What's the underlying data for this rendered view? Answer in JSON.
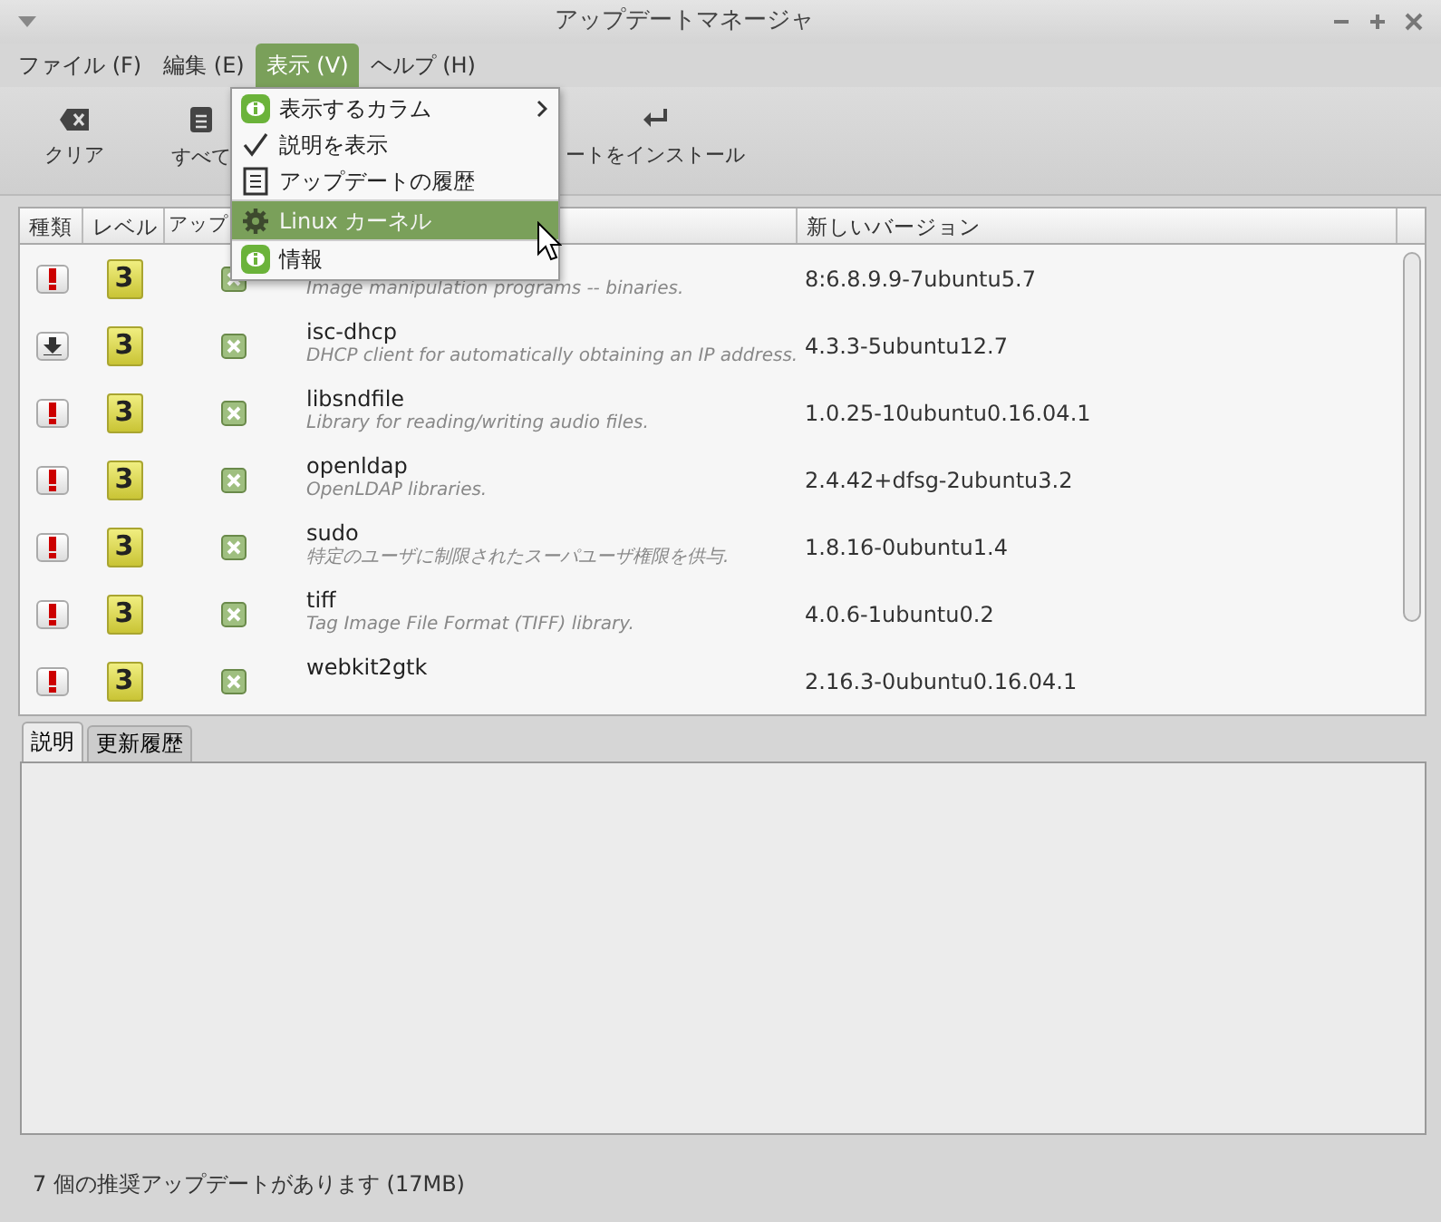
{
  "window": {
    "title": "アップデートマネージャ"
  },
  "menubar": [
    {
      "label": "ファイル (F)",
      "selected": false
    },
    {
      "label": "編集 (E)",
      "selected": false
    },
    {
      "label": "表示 (V)",
      "selected": true
    },
    {
      "label": "ヘルプ (H)",
      "selected": false
    }
  ],
  "toolbar": [
    {
      "label": "クリア",
      "kind": "clear"
    },
    {
      "label": "すべて",
      "kind": "select"
    },
    {
      "label": "ートをインストール",
      "kind": "install"
    }
  ],
  "view_menu": [
    {
      "label": "表示するカラム",
      "kind": "submenu",
      "selected": false
    },
    {
      "label": "説明を表示",
      "kind": "check",
      "checked": true,
      "selected": false
    },
    {
      "label": "アップデートの履歴",
      "kind": "history",
      "selected": false
    },
    {
      "label": "Linux カーネル",
      "kind": "gear",
      "selected": true
    },
    {
      "label": "情報",
      "kind": "info",
      "selected": false
    }
  ],
  "table": {
    "columns": [
      "種類",
      "レベル",
      "アップ",
      "新しいバージョン"
    ],
    "rows": [
      {
        "kind": "security",
        "level": "3",
        "checked": true,
        "description": "Image manipulation programs -- binaries.",
        "version": "8:6.8.9.9-7ubuntu5.7"
      },
      {
        "kind": "download",
        "level": "3",
        "checked": true,
        "package": "isc-dhcp",
        "description": "DHCP client for automatically obtaining an IP address.",
        "version": "4.3.3-5ubuntu12.7"
      },
      {
        "kind": "security",
        "level": "3",
        "checked": true,
        "package": "libsndfile",
        "description": "Library for reading/writing audio files.",
        "version": "1.0.25-10ubuntu0.16.04.1"
      },
      {
        "kind": "security",
        "level": "3",
        "checked": true,
        "package": "openldap",
        "description": "OpenLDAP libraries.",
        "version": "2.4.42+dfsg-2ubuntu3.2"
      },
      {
        "kind": "security",
        "level": "3",
        "checked": true,
        "package": "sudo",
        "description": "特定のユーザに制限されたスーパユーザ権限を供与.",
        "version": "1.8.16-0ubuntu1.4"
      },
      {
        "kind": "security",
        "level": "3",
        "checked": true,
        "package": "tiff",
        "description": "Tag Image File Format (TIFF) library.",
        "version": "4.0.6-1ubuntu0.2"
      },
      {
        "kind": "security",
        "level": "3",
        "checked": true,
        "package": "webkit2gtk",
        "version": "2.16.3-0ubuntu0.16.04.1"
      }
    ]
  },
  "tabs": [
    {
      "label": "説明",
      "selected": true
    },
    {
      "label": "更新履歴",
      "selected": false
    }
  ],
  "status_bar": "7 個の推奨アップデートがあります (17MB)"
}
